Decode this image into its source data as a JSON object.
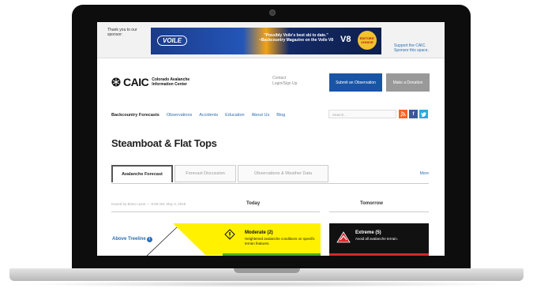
{
  "sponsor": {
    "thanks": "Thank you to our sponsor:",
    "banner_logo": "VOILE",
    "banner_quote": "\"Possibly Voile's best ski to date.\" ~Backcountry Magazine on the Voile V8",
    "banner_model": "V8",
    "banner_badge": "EDITORS' CHOICE",
    "support": "Support the CAIC. Sponsor this space."
  },
  "header": {
    "logo_text": "CAIC",
    "logo_sub": "Colorado Avalanche Information Center",
    "contact": "Contact",
    "login": "Login/Sign Up",
    "submit_btn": "Submit an Observation",
    "donate_btn": "Make a Donation"
  },
  "nav": {
    "items": [
      "Backcountry Forecasts",
      "Observations",
      "Accidents",
      "Education",
      "About Us",
      "Blog"
    ],
    "search_placeholder": "Search..."
  },
  "social": {
    "icons": [
      "rss-icon",
      "facebook-icon",
      "twitter-icon"
    ],
    "colors": {
      "rss": "#f26522",
      "facebook": "#3b5998",
      "twitter": "#29a9e0"
    }
  },
  "page": {
    "title": "Steamboat & Flat Tops"
  },
  "tabs": {
    "items": [
      "Avalanche Forecast",
      "Forecast Discussion",
      "Observations & Weather Data"
    ],
    "active": 0,
    "more": "More"
  },
  "forecast": {
    "issued": "Issued by Brian Lazar — 6:59 AM, May 3, 2016",
    "today_label": "Today",
    "tomorrow_label": "Tomorrow",
    "zone": "Above Treeline",
    "today": {
      "rating": "Moderate (2)",
      "description": "Heightened avalanche conditions on specific terrain features.",
      "color": "#fff100"
    },
    "tomorrow": {
      "rating": "Extreme (5)",
      "description": "Avoid all avalanche terrain.",
      "color": "#111111"
    }
  },
  "colors": {
    "accent_blue": "#1a54a6",
    "link": "#2a6fb3"
  }
}
